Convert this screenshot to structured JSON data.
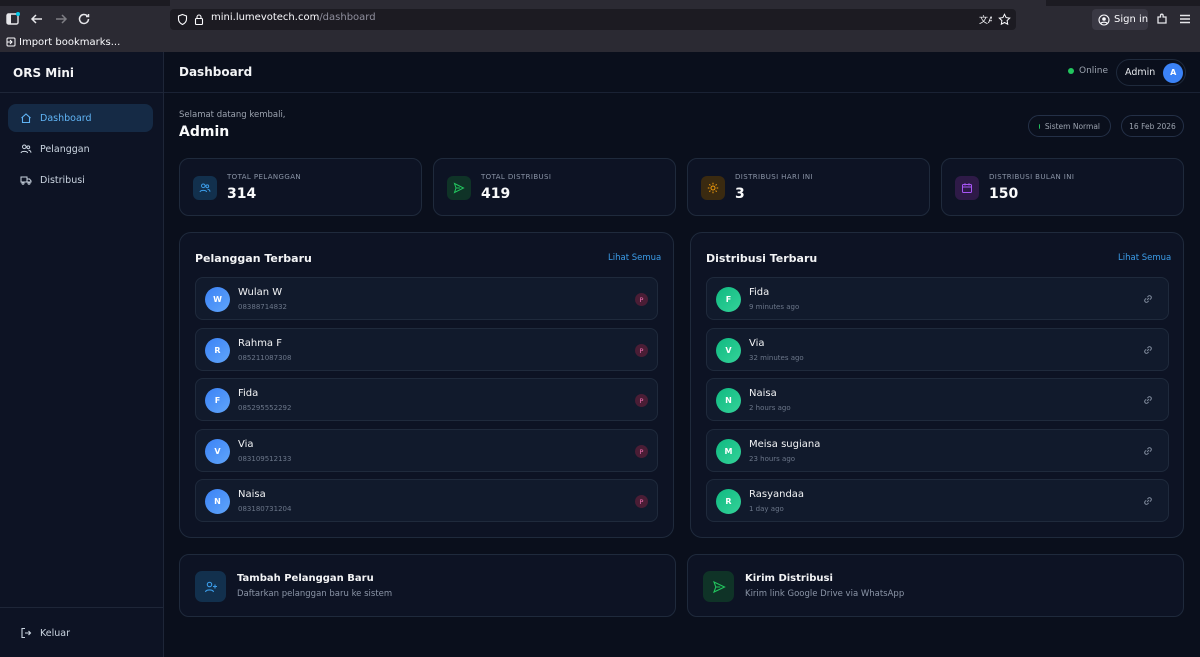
{
  "browser": {
    "url_host": "mini.lumevotech.com",
    "url_path": "/dashboard",
    "sign_in_label": "Sign in",
    "bookmark_label": "Import bookmarks..."
  },
  "sidebar": {
    "brand": "ORS Mini",
    "items": [
      {
        "label": "Dashboard",
        "icon": "home-icon",
        "active": true
      },
      {
        "label": "Pelanggan",
        "icon": "users-icon",
        "active": false
      },
      {
        "label": "Distribusi",
        "icon": "truck-icon",
        "active": false
      }
    ],
    "logout_label": "Keluar"
  },
  "header": {
    "title": "Dashboard",
    "status": "Online",
    "user": "Admin",
    "avatar_initial": "A"
  },
  "welcome": {
    "greeting": "Selamat datang kembali,",
    "name": "Admin",
    "system_status": "Sistem Normal",
    "date": "16 Feb 2026"
  },
  "stats": [
    {
      "label": "TOTAL PELANGGAN",
      "value": "314",
      "icon": "users-icon",
      "color": "#3b9ce8"
    },
    {
      "label": "TOTAL DISTRIBUSI",
      "value": "419",
      "icon": "send-icon",
      "color": "#22c55e"
    },
    {
      "label": "DISTRIBUSI HARI INI",
      "value": "3",
      "icon": "sun-icon",
      "color": "#f59e0b"
    },
    {
      "label": "DISTRIBUSI BULAN INI",
      "value": "150",
      "icon": "calendar-icon",
      "color": "#a855f7"
    }
  ],
  "recent_customers": {
    "title": "Pelanggan Terbaru",
    "link": "Lihat Semua",
    "items": [
      {
        "initial": "W",
        "name": "Wulan W",
        "phone": "08388714832",
        "badge": "P"
      },
      {
        "initial": "R",
        "name": "Rahma F",
        "phone": "085211087308",
        "badge": "P"
      },
      {
        "initial": "F",
        "name": "Fida",
        "phone": "085295552292",
        "badge": "P"
      },
      {
        "initial": "V",
        "name": "Via",
        "phone": "083109512133",
        "badge": "P"
      },
      {
        "initial": "N",
        "name": "Naisa",
        "phone": "083180731204",
        "badge": "P"
      }
    ]
  },
  "recent_distributions": {
    "title": "Distribusi Terbaru",
    "link": "Lihat Semua",
    "items": [
      {
        "initial": "F",
        "name": "Fida",
        "time": "9 minutes ago"
      },
      {
        "initial": "V",
        "name": "Via",
        "time": "32 minutes ago"
      },
      {
        "initial": "N",
        "name": "Naisa",
        "time": "2 hours ago"
      },
      {
        "initial": "M",
        "name": "Meisa sugiana",
        "time": "23 hours ago"
      },
      {
        "initial": "R",
        "name": "Rasyandaa",
        "time": "1 day ago"
      }
    ]
  },
  "actions": [
    {
      "title": "Tambah Pelanggan Baru",
      "subtitle": "Daftarkan pelanggan baru ke sistem",
      "icon": "user-plus-icon",
      "color": "#3b9ce8"
    },
    {
      "title": "Kirim Distribusi",
      "subtitle": "Kirim link Google Drive via WhatsApp",
      "icon": "send-icon",
      "color": "#22c55e"
    }
  ]
}
